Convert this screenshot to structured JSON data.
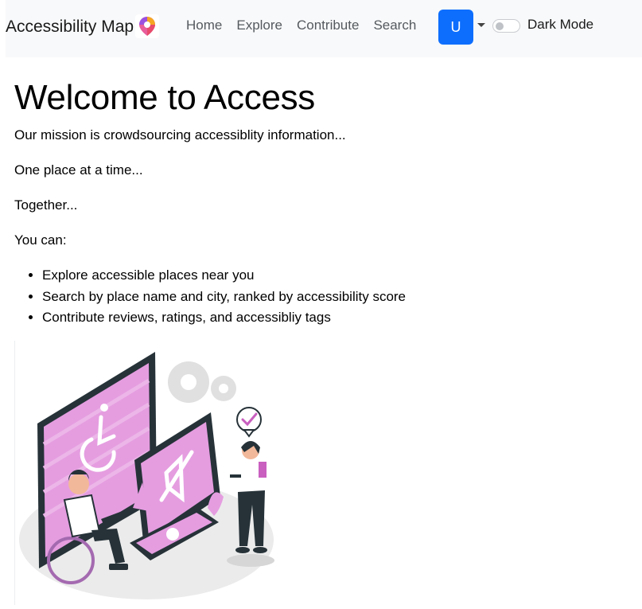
{
  "navbar": {
    "brand": "Accessibility Map",
    "links": [
      "Home",
      "Explore",
      "Contribute",
      "Search"
    ],
    "user_initial": "U",
    "dark_mode_label": "Dark Mode"
  },
  "main": {
    "heading": "Welcome to Access",
    "paragraphs": [
      "Our mission is crowdsourcing accessiblity information...",
      "One place at a time...",
      "Together...",
      "You can:"
    ],
    "features": [
      "Explore accessible places near you",
      "Search by place name and city, ranked by accessibility score",
      "Contribute reviews, ratings, and accessibliy tags"
    ]
  },
  "colors": {
    "primary": "#0d6efd",
    "navbar_bg": "#f8f9fa",
    "illustration_pink": "#e59de0",
    "illustration_dark": "#263238"
  }
}
